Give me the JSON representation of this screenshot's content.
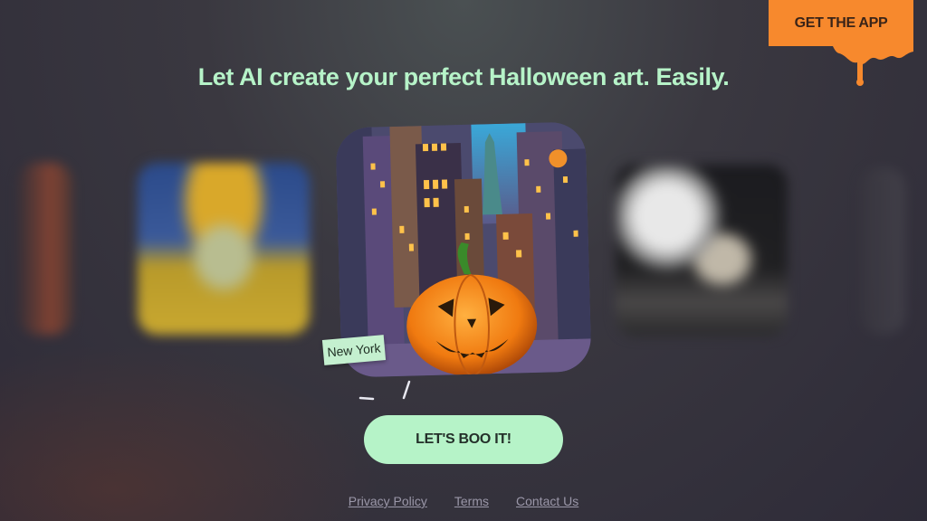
{
  "header": {
    "get_app_label": "GET THE APP",
    "accent_color": "#f7892d"
  },
  "hero": {
    "headline": "Let AI create your perfect Halloween art. Easily.",
    "headline_color": "#b6f3c8"
  },
  "carousel": {
    "cards": [
      {
        "subject": "blurred orange card edge"
      },
      {
        "subject": "skull in yellow hat"
      },
      {
        "subject": "New York pumpkin city",
        "active": true,
        "tag": "New York"
      },
      {
        "subject": "skeleton under full moon"
      },
      {
        "subject": "blurred card edge"
      }
    ]
  },
  "cta": {
    "label": "LET'S BOO IT!",
    "color": "#b6f3c8"
  },
  "footer": {
    "links": [
      "Privacy Policy",
      "Terms",
      "Contact Us"
    ]
  }
}
